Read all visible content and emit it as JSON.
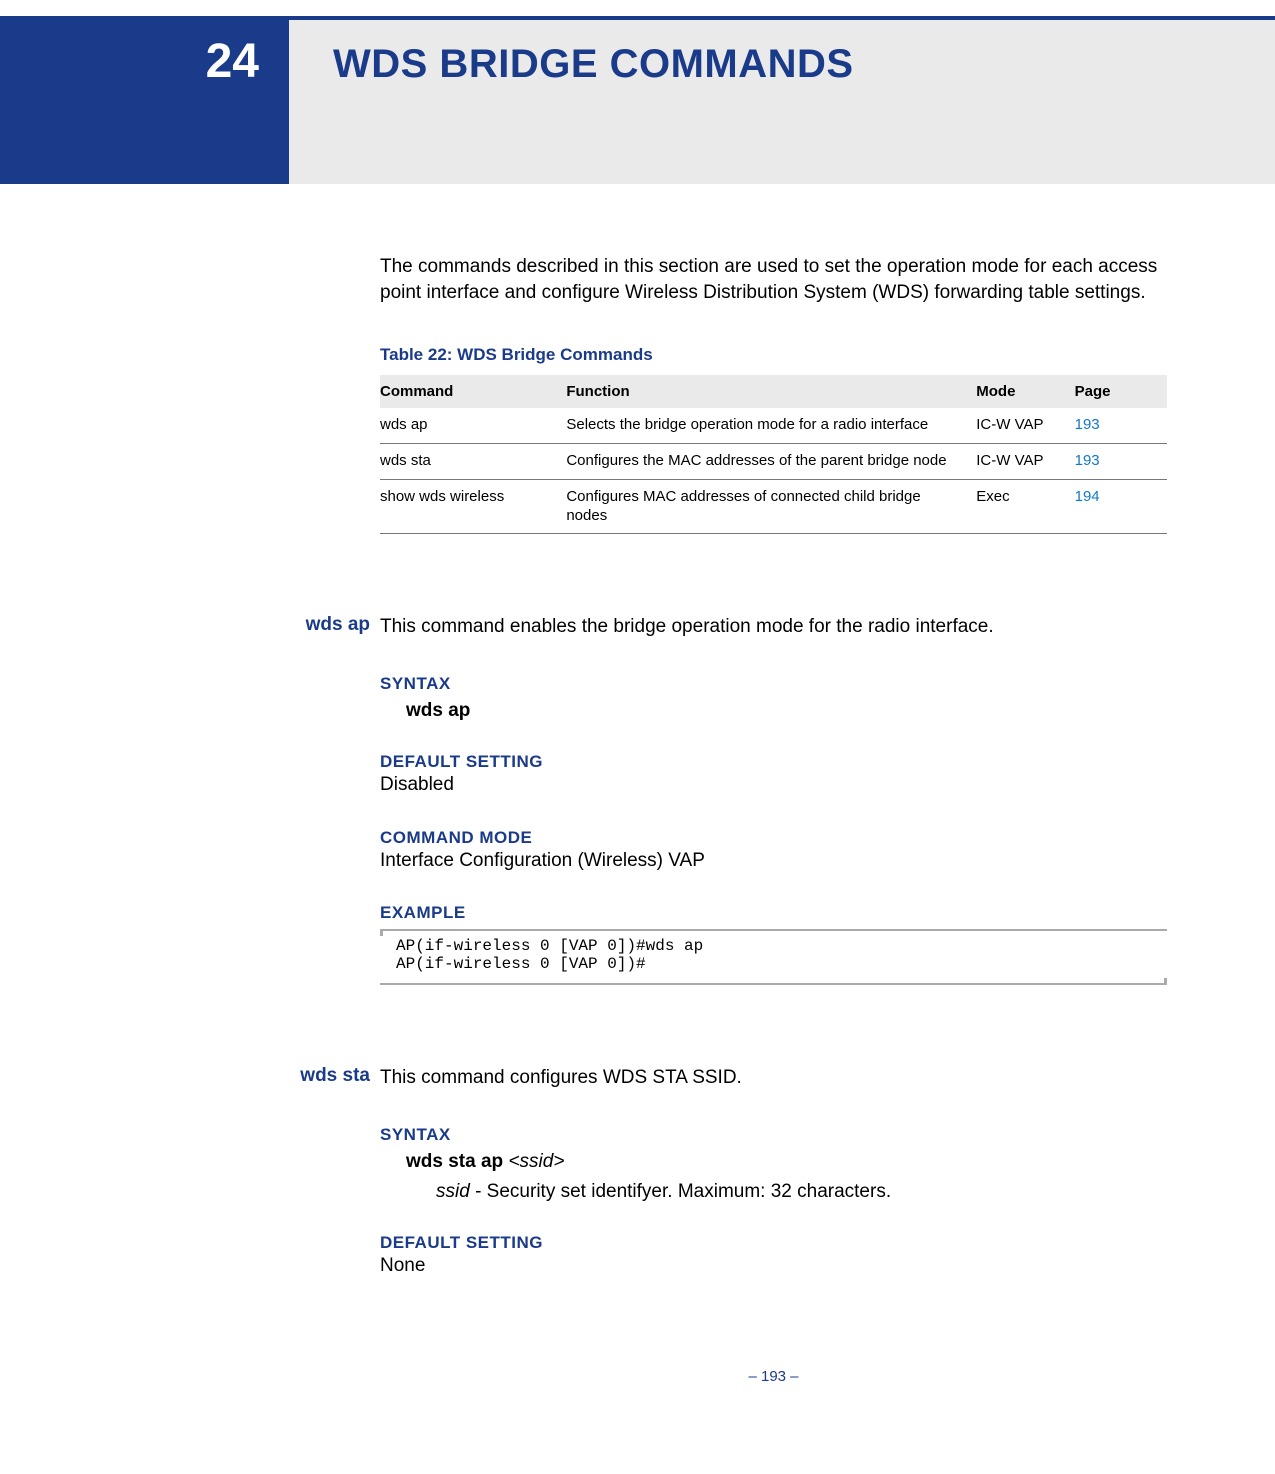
{
  "chapter_number": "24",
  "chapter_title": "WDS BRIDGE COMMANDS",
  "intro": "The commands described in this section are used to set the operation mode for each access point interface and configure Wireless Distribution System (WDS) forwarding table settings.",
  "table": {
    "caption": "Table 22: WDS Bridge Commands",
    "headers": {
      "command": "Command",
      "function": "Function",
      "mode": "Mode",
      "page": "Page"
    },
    "rows": [
      {
        "command": "wds ap",
        "function": "Selects the bridge operation mode for a radio interface",
        "mode": "IC-W VAP",
        "page": "193"
      },
      {
        "command": "wds sta",
        "function": "Configures the MAC addresses of the parent bridge node",
        "mode": "IC-W VAP",
        "page": "193"
      },
      {
        "command": "show wds wireless",
        "function": "Configures MAC addresses of connected child bridge nodes",
        "mode": "Exec",
        "page": "194"
      }
    ]
  },
  "sections": {
    "syntax_label": "SYNTAX",
    "default_label": "DEFAULT SETTING",
    "mode_label": "COMMAND MODE",
    "example_label": "EXAMPLE"
  },
  "wds_ap": {
    "name": "wds ap",
    "desc": "This command enables the bridge operation mode for the radio interface.",
    "syntax": "wds ap",
    "default": "Disabled",
    "mode": "Interface Configuration (Wireless) VAP",
    "example": "AP(if-wireless 0 [VAP 0])#wds ap\nAP(if-wireless 0 [VAP 0])#"
  },
  "wds_sta": {
    "name": "wds sta",
    "desc": "This command configures WDS STA SSID.",
    "syntax_kw": "wds sta ap",
    "syntax_arg": "<ssid>",
    "param_arg": "ssid",
    "param_desc": " - Security set identifyer. Maximum: 32 characters.",
    "default": "None"
  },
  "footer": "–  193  –"
}
